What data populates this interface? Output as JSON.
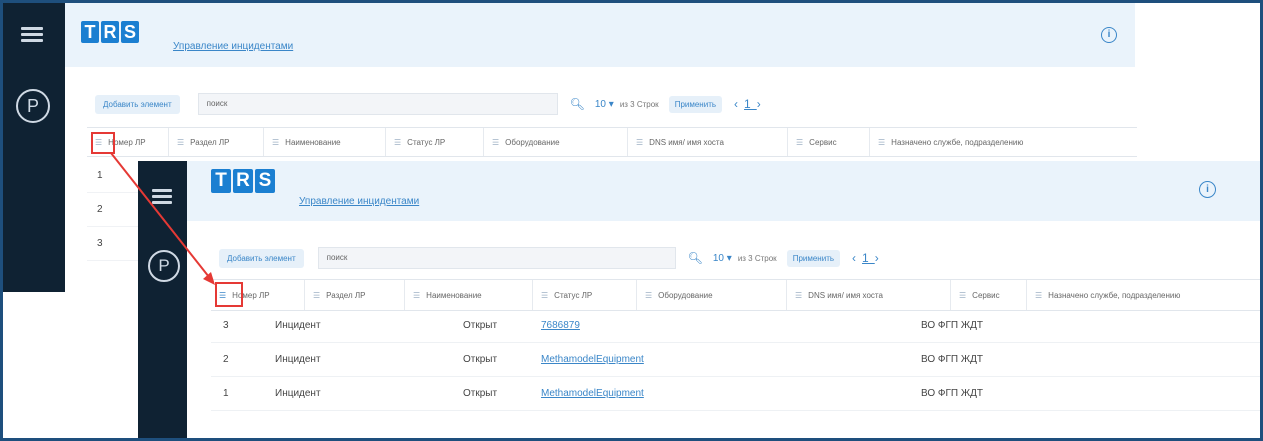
{
  "app": {
    "logo_letters": [
      "T",
      "R",
      "S"
    ],
    "breadcrumb": "Управление инцидентами",
    "info_icon": "ⓘ",
    "profile_letter": "P"
  },
  "toolbar": {
    "add_label": "Добавить элемент",
    "search_value": "поиск",
    "page_size": "10",
    "rows_total": "из 3 Строк",
    "apply_label": "Применить",
    "pager_prev": "‹",
    "pager_current": "1",
    "pager_next": "›"
  },
  "columns": [
    "Номер ЛР",
    "Раздел ЛР",
    "Наименование",
    "Статус ЛР",
    "Оборудование",
    "DNS имя/ имя хоста",
    "Сервис",
    "Назначено службе, подразделению"
  ],
  "before_rows": [
    "1",
    "2",
    "3"
  ],
  "after_rows": [
    {
      "num": "3",
      "section": "Инцидент",
      "status": "Открыт",
      "equipment": "7686879",
      "service": "ВО ФГП ЖДТ"
    },
    {
      "num": "2",
      "section": "Инцидент",
      "status": "Открыт",
      "equipment": "MethamodelEquipment",
      "service": "ВО ФГП ЖДТ"
    },
    {
      "num": "1",
      "section": "Инцидент",
      "status": "Открыт",
      "equipment": "MethamodelEquipment",
      "service": "ВО ФГП ЖДТ"
    }
  ],
  "colors": {
    "sidebar": "#0f2233",
    "accent": "#1b7fd1",
    "highlight": "#e53935",
    "frame": "#1e4f7d"
  },
  "icons": [
    "menu-icon",
    "profile-icon",
    "info-icon",
    "search-icon",
    "sort-icon",
    "dropdown-icon"
  ]
}
